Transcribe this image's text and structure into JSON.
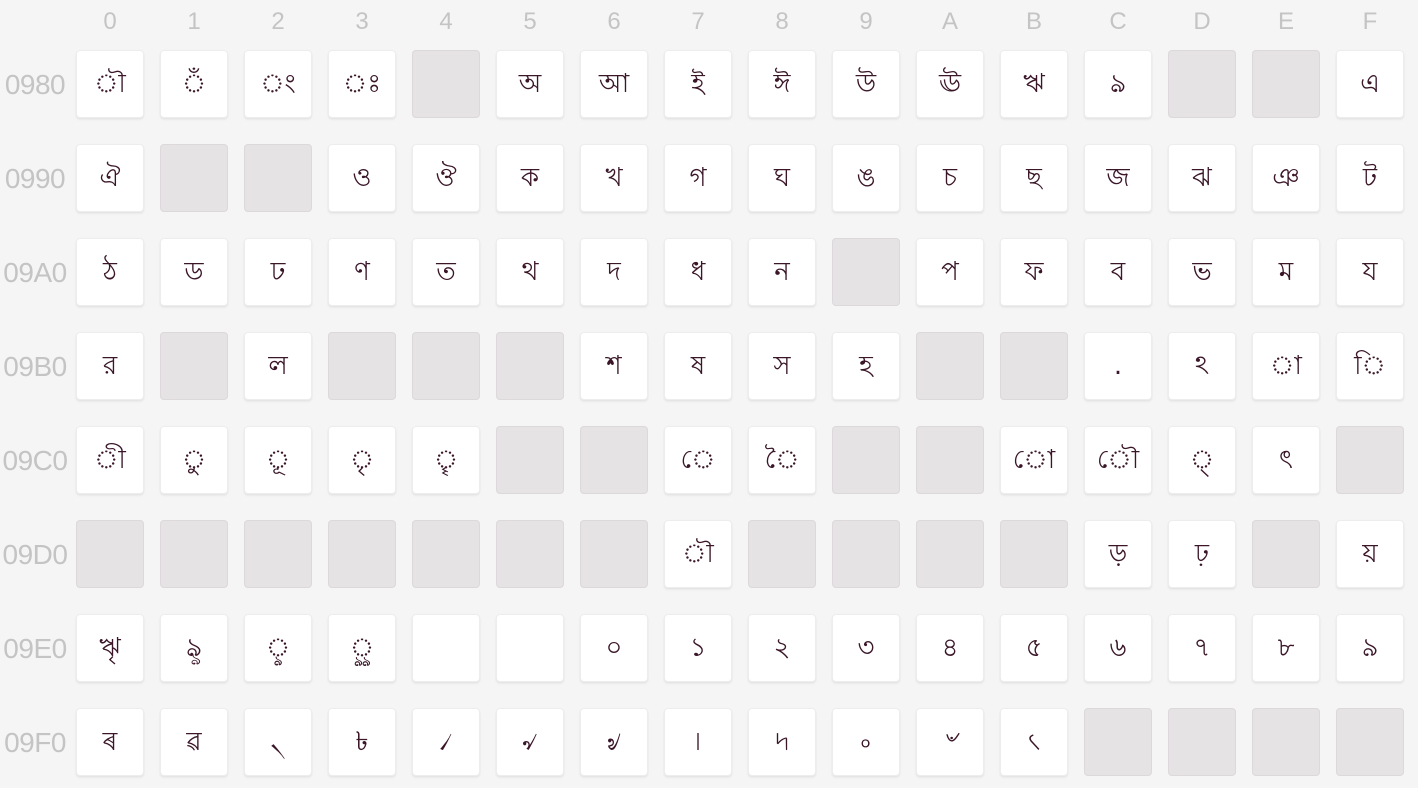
{
  "column_headers": [
    "0",
    "1",
    "2",
    "3",
    "4",
    "5",
    "6",
    "7",
    "8",
    "9",
    "A",
    "B",
    "C",
    "D",
    "E",
    "F"
  ],
  "rows": [
    {
      "label": "0980",
      "cells": [
        {
          "char": "ৗ",
          "status": "assigned"
        },
        {
          "char": "ঁ",
          "status": "assigned"
        },
        {
          "char": "ং",
          "status": "assigned"
        },
        {
          "char": "ঃ",
          "status": "assigned"
        },
        {
          "char": "",
          "status": "unassigned"
        },
        {
          "char": "অ",
          "status": "assigned"
        },
        {
          "char": "আ",
          "status": "assigned"
        },
        {
          "char": "ই",
          "status": "assigned"
        },
        {
          "char": "ঈ",
          "status": "assigned"
        },
        {
          "char": "উ",
          "status": "assigned"
        },
        {
          "char": "ঊ",
          "status": "assigned"
        },
        {
          "char": "ঋ",
          "status": "assigned"
        },
        {
          "char": "ঌ",
          "status": "assigned"
        },
        {
          "char": "",
          "status": "unassigned"
        },
        {
          "char": "",
          "status": "unassigned"
        },
        {
          "char": "এ",
          "status": "assigned"
        }
      ]
    },
    {
      "label": "0990",
      "cells": [
        {
          "char": "ঐ",
          "status": "assigned"
        },
        {
          "char": "",
          "status": "unassigned"
        },
        {
          "char": "",
          "status": "unassigned"
        },
        {
          "char": "ও",
          "status": "assigned"
        },
        {
          "char": "ঔ",
          "status": "assigned"
        },
        {
          "char": "ক",
          "status": "assigned"
        },
        {
          "char": "খ",
          "status": "assigned"
        },
        {
          "char": "গ",
          "status": "assigned"
        },
        {
          "char": "ঘ",
          "status": "assigned"
        },
        {
          "char": "ঙ",
          "status": "assigned"
        },
        {
          "char": "চ",
          "status": "assigned"
        },
        {
          "char": "ছ",
          "status": "assigned"
        },
        {
          "char": "জ",
          "status": "assigned"
        },
        {
          "char": "ঝ",
          "status": "assigned"
        },
        {
          "char": "ঞ",
          "status": "assigned"
        },
        {
          "char": "ট",
          "status": "assigned"
        }
      ]
    },
    {
      "label": "09A0",
      "cells": [
        {
          "char": "ঠ",
          "status": "assigned"
        },
        {
          "char": "ড",
          "status": "assigned"
        },
        {
          "char": "ঢ",
          "status": "assigned"
        },
        {
          "char": "ণ",
          "status": "assigned"
        },
        {
          "char": "ত",
          "status": "assigned"
        },
        {
          "char": "থ",
          "status": "assigned"
        },
        {
          "char": "দ",
          "status": "assigned"
        },
        {
          "char": "ধ",
          "status": "assigned"
        },
        {
          "char": "ন",
          "status": "assigned"
        },
        {
          "char": "",
          "status": "unassigned"
        },
        {
          "char": "প",
          "status": "assigned"
        },
        {
          "char": "ফ",
          "status": "assigned"
        },
        {
          "char": "ব",
          "status": "assigned"
        },
        {
          "char": "ভ",
          "status": "assigned"
        },
        {
          "char": "ম",
          "status": "assigned"
        },
        {
          "char": "য",
          "status": "assigned"
        }
      ]
    },
    {
      "label": "09B0",
      "cells": [
        {
          "char": "র",
          "status": "assigned"
        },
        {
          "char": "",
          "status": "unassigned"
        },
        {
          "char": "ল",
          "status": "assigned"
        },
        {
          "char": "",
          "status": "unassigned"
        },
        {
          "char": "",
          "status": "unassigned"
        },
        {
          "char": "",
          "status": "unassigned"
        },
        {
          "char": "শ",
          "status": "assigned"
        },
        {
          "char": "ষ",
          "status": "assigned"
        },
        {
          "char": "স",
          "status": "assigned"
        },
        {
          "char": "হ",
          "status": "assigned"
        },
        {
          "char": "",
          "status": "unassigned"
        },
        {
          "char": "",
          "status": "unassigned"
        },
        {
          "char": ".",
          "status": "assigned"
        },
        {
          "char": "ঽ",
          "status": "assigned"
        },
        {
          "char": "া",
          "status": "assigned"
        },
        {
          "char": "ি",
          "status": "assigned"
        }
      ]
    },
    {
      "label": "09C0",
      "cells": [
        {
          "char": "ী",
          "status": "assigned"
        },
        {
          "char": "ু",
          "status": "assigned"
        },
        {
          "char": "ূ",
          "status": "assigned"
        },
        {
          "char": "ৃ",
          "status": "assigned"
        },
        {
          "char": "ৄ",
          "status": "assigned"
        },
        {
          "char": "",
          "status": "unassigned"
        },
        {
          "char": "",
          "status": "unassigned"
        },
        {
          "char": "ে",
          "status": "assigned"
        },
        {
          "char": "ৈ",
          "status": "assigned"
        },
        {
          "char": "",
          "status": "unassigned"
        },
        {
          "char": "",
          "status": "unassigned"
        },
        {
          "char": "ো",
          "status": "assigned"
        },
        {
          "char": "ৌ",
          "status": "assigned"
        },
        {
          "char": "্",
          "status": "assigned"
        },
        {
          "char": "ৎ",
          "status": "assigned"
        },
        {
          "char": "",
          "status": "unassigned"
        }
      ]
    },
    {
      "label": "09D0",
      "cells": [
        {
          "char": "",
          "status": "unassigned"
        },
        {
          "char": "",
          "status": "unassigned"
        },
        {
          "char": "",
          "status": "unassigned"
        },
        {
          "char": "",
          "status": "unassigned"
        },
        {
          "char": "",
          "status": "unassigned"
        },
        {
          "char": "",
          "status": "unassigned"
        },
        {
          "char": "",
          "status": "unassigned"
        },
        {
          "char": "ৗ",
          "status": "assigned"
        },
        {
          "char": "",
          "status": "unassigned"
        },
        {
          "char": "",
          "status": "unassigned"
        },
        {
          "char": "",
          "status": "unassigned"
        },
        {
          "char": "",
          "status": "unassigned"
        },
        {
          "char": "ড়",
          "status": "assigned"
        },
        {
          "char": "ঢ়",
          "status": "assigned"
        },
        {
          "char": "",
          "status": "unassigned"
        },
        {
          "char": "য়",
          "status": "assigned"
        }
      ]
    },
    {
      "label": "09E0",
      "cells": [
        {
          "char": "ৠ",
          "status": "assigned"
        },
        {
          "char": "ৡ",
          "status": "assigned"
        },
        {
          "char": "ৢ",
          "status": "assigned"
        },
        {
          "char": "ৣ",
          "status": "assigned"
        },
        {
          "char": "",
          "status": "format"
        },
        {
          "char": "",
          "status": "format"
        },
        {
          "char": "০",
          "status": "assigned"
        },
        {
          "char": "১",
          "status": "assigned"
        },
        {
          "char": "২",
          "status": "assigned"
        },
        {
          "char": "৩",
          "status": "assigned"
        },
        {
          "char": "৪",
          "status": "assigned"
        },
        {
          "char": "৫",
          "status": "assigned"
        },
        {
          "char": "৬",
          "status": "assigned"
        },
        {
          "char": "৭",
          "status": "assigned"
        },
        {
          "char": "৮",
          "status": "assigned"
        },
        {
          "char": "৯",
          "status": "assigned"
        }
      ]
    },
    {
      "label": "09F0",
      "cells": [
        {
          "char": "ৰ",
          "status": "assigned"
        },
        {
          "char": "ৱ",
          "status": "assigned"
        },
        {
          "char": "৲",
          "status": "assigned"
        },
        {
          "char": "৳",
          "status": "assigned"
        },
        {
          "char": "৴",
          "status": "assigned"
        },
        {
          "char": "৵",
          "status": "assigned"
        },
        {
          "char": "৶",
          "status": "assigned"
        },
        {
          "char": "৷",
          "status": "assigned"
        },
        {
          "char": "৸",
          "status": "assigned"
        },
        {
          "char": "৹",
          "status": "assigned"
        },
        {
          "char": "৺",
          "status": "assigned"
        },
        {
          "char": "৻",
          "status": "assigned"
        },
        {
          "char": "",
          "status": "unassigned"
        },
        {
          "char": "",
          "status": "unassigned"
        },
        {
          "char": "",
          "status": "unassigned"
        },
        {
          "char": "",
          "status": "unassigned"
        }
      ]
    }
  ]
}
